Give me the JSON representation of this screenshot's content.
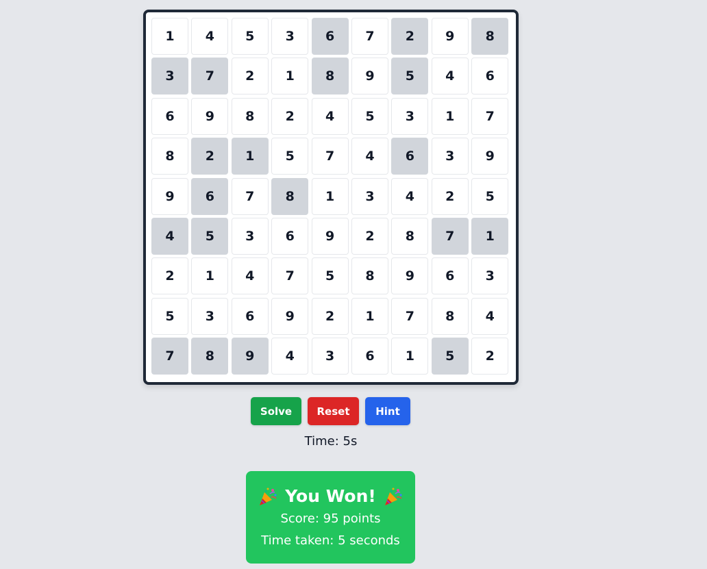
{
  "grid": [
    [
      "1",
      "4",
      "5",
      "3",
      "6",
      "7",
      "2",
      "9",
      "8"
    ],
    [
      "3",
      "7",
      "2",
      "1",
      "8",
      "9",
      "5",
      "4",
      "6"
    ],
    [
      "6",
      "9",
      "8",
      "2",
      "4",
      "5",
      "3",
      "1",
      "7"
    ],
    [
      "8",
      "2",
      "1",
      "5",
      "7",
      "4",
      "6",
      "3",
      "9"
    ],
    [
      "9",
      "6",
      "7",
      "8",
      "1",
      "3",
      "4",
      "2",
      "5"
    ],
    [
      "4",
      "5",
      "3",
      "6",
      "9",
      "2",
      "8",
      "7",
      "1"
    ],
    [
      "2",
      "1",
      "4",
      "7",
      "5",
      "8",
      "9",
      "6",
      "3"
    ],
    [
      "5",
      "3",
      "6",
      "9",
      "2",
      "1",
      "7",
      "8",
      "4"
    ],
    [
      "7",
      "8",
      "9",
      "4",
      "3",
      "6",
      "1",
      "5",
      "2"
    ]
  ],
  "given": [
    [
      false,
      false,
      false,
      false,
      true,
      false,
      true,
      false,
      true
    ],
    [
      true,
      true,
      false,
      false,
      true,
      false,
      true,
      false,
      false
    ],
    [
      false,
      false,
      false,
      false,
      false,
      false,
      false,
      false,
      false
    ],
    [
      false,
      true,
      true,
      false,
      false,
      false,
      true,
      false,
      false
    ],
    [
      false,
      true,
      false,
      true,
      false,
      false,
      false,
      false,
      false
    ],
    [
      true,
      true,
      false,
      false,
      false,
      false,
      false,
      true,
      true
    ],
    [
      false,
      false,
      false,
      false,
      false,
      false,
      false,
      false,
      false
    ],
    [
      false,
      false,
      false,
      false,
      false,
      false,
      false,
      false,
      false
    ],
    [
      true,
      true,
      true,
      false,
      false,
      false,
      false,
      true,
      false
    ]
  ],
  "controls": {
    "solve_label": "Solve",
    "reset_label": "Reset",
    "hint_label": "Hint"
  },
  "timer": {
    "text": "Time: 5s"
  },
  "win": {
    "title": "You Won!",
    "score": "Score: 95 points",
    "time_taken": "Time taken: 5 seconds",
    "icon": "party-popper-icon"
  },
  "colors": {
    "given_cell": "#d1d5db",
    "solve": "#16a34a",
    "reset": "#dc2626",
    "hint": "#2563eb",
    "win_banner": "#22c55e",
    "board_border": "#1f2937"
  }
}
